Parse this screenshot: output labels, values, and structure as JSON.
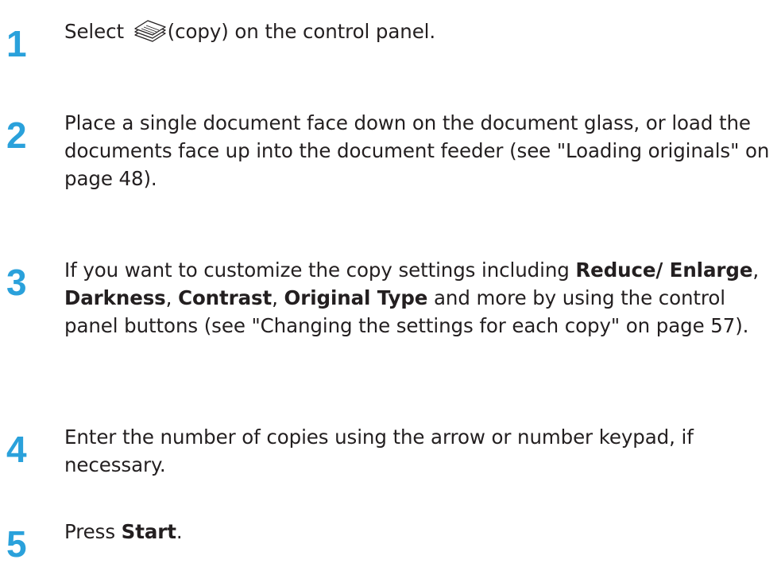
{
  "steps": [
    {
      "number": "1",
      "parts": [
        {
          "text": "Select "
        },
        {
          "icon": "copy-icon"
        },
        {
          "text": "(copy) on the control panel."
        }
      ]
    },
    {
      "number": "2",
      "parts": [
        {
          "text": "Place a single document face down on the document glass, or load the documents face up into the document feeder (see \"Loading originals\" on page 48)."
        }
      ]
    },
    {
      "number": "3",
      "parts": [
        {
          "text": "If you want to customize the copy settings including "
        },
        {
          "text": "Reduce/ Enlarge",
          "bold": true
        },
        {
          "text": ", "
        },
        {
          "text": "Darkness",
          "bold": true
        },
        {
          "text": ", "
        },
        {
          "text": "Contrast",
          "bold": true
        },
        {
          "text": ", "
        },
        {
          "text": "Original Type",
          "bold": true
        },
        {
          "text": " and more by using the control panel buttons (see \"Changing the settings for each copy\" on page 57)."
        }
      ]
    },
    {
      "number": "4",
      "parts": [
        {
          "text": "Enter the number of copies using the arrow or number keypad, if necessary."
        }
      ]
    },
    {
      "number": "5",
      "parts": [
        {
          "text": "Press "
        },
        {
          "text": "Start",
          "bold": true
        },
        {
          "text": "."
        }
      ]
    }
  ],
  "colors": {
    "step_number": "#2aa1db",
    "body_text": "#231f20"
  }
}
